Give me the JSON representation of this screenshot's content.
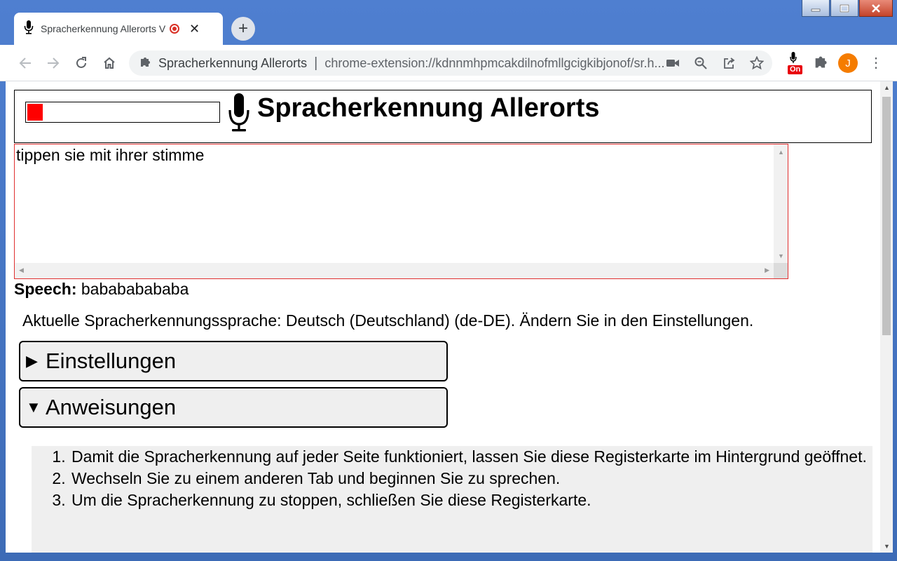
{
  "browser": {
    "tab": {
      "title": "Spracherkennung Allerorts V",
      "close_glyph": "✕"
    },
    "new_tab_glyph": "+",
    "omnibox": {
      "site_name": "Spracherkennung Allerorts",
      "separator": "|",
      "url": "chrome-extension://kdnnmhpmcakdilnofmllgcigkibjonof/sr.h..."
    },
    "extension_badge": "On",
    "avatar_letter": "J",
    "menu_glyph": "⋮"
  },
  "app": {
    "title": "Spracherkennung Allerorts",
    "level_meter_fraction": 0.08,
    "transcript": "tippen sie mit ihrer stimme",
    "speech_label": "Speech:",
    "speech_value": "babababababa",
    "current_language_text": "Aktuelle Spracherkennungssprache: Deutsch (Deutschland) (de-DE). Ändern Sie in den Einstellungen.",
    "settings": {
      "triangle": "▶",
      "label": "Einstellungen",
      "expanded": false
    },
    "instructions": {
      "triangle": "▼",
      "label": "Anweisungen",
      "expanded": true,
      "items": [
        "Damit die Spracherkennung auf jeder Seite funktioniert, lassen Sie diese Registerkarte im Hintergrund geöffnet.",
        "Wechseln Sie zu einem anderen Tab und beginnen Sie zu sprechen.",
        "Um die Spracherkennung zu stoppen, schließen Sie diese Registerkarte."
      ]
    }
  },
  "colors": {
    "accent_red": "#ff0000",
    "avatar_orange": "#f57c00",
    "window_blue": "#3d6bb6"
  }
}
